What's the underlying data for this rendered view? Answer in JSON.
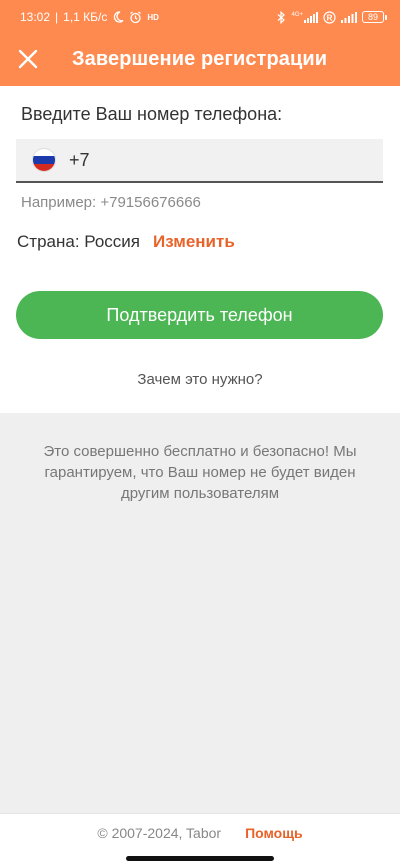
{
  "status_bar": {
    "time": "13:02",
    "network_speed": "1,1 КБ/с",
    "hd_label": "HD",
    "signal_label": "4G+",
    "battery": "89",
    "icons": [
      "moon-icon",
      "alarm-icon",
      "bluetooth-icon",
      "signal-icon",
      "roaming-icon",
      "battery-icon"
    ]
  },
  "header": {
    "title": "Завершение регистрации",
    "background": "#ff8a4f"
  },
  "form": {
    "prompt": "Введите Ваш номер телефона:",
    "country_code": "+7",
    "example": "Например: +79156676666",
    "country_label": "Страна: Россия",
    "change_link": "Изменить",
    "confirm_button": "Подтвердить телефон",
    "why_link": "Зачем это нужно?"
  },
  "info": {
    "text": "Это совершенно бесплатно и безопасно! Мы гарантируем, что Ваш номер не будет виден другим пользователям"
  },
  "footer": {
    "copyright": "© 2007-2024, Tabor",
    "help_link": "Помощь"
  },
  "colors": {
    "accent": "#e8632a",
    "button_green": "#4cb655"
  }
}
